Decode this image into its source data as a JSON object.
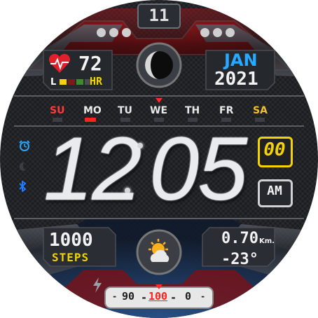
{
  "date": {
    "day_of_month": "11",
    "month": "JAN",
    "year": "2021"
  },
  "heart": {
    "value": "72",
    "unit": "HR",
    "level_prefix": "L",
    "level_index": 1
  },
  "weekdays": {
    "items": [
      "SU",
      "MO",
      "TU",
      "WE",
      "TH",
      "FR",
      "SA"
    ],
    "selected_index": 1,
    "colors": {
      "sunday": "#ff3b3b",
      "saturday": "#f2c12e",
      "default": "#e8e8e8",
      "selected_marker": "#ff2020"
    }
  },
  "time": {
    "hour": "12",
    "minute": "05",
    "seconds": "00",
    "ampm": "AM"
  },
  "steps": {
    "value": "1000",
    "label": "STEPS"
  },
  "distance": {
    "value": "0.70",
    "unit": "Km."
  },
  "weather": {
    "temperature": "-23°",
    "icon": "sun-cloud-icon"
  },
  "battery": {
    "left_label": "90",
    "value": "100",
    "right_label": "0"
  },
  "colors": {
    "accent_blue": "#29a8ff",
    "accent_yellow": "#f5d300",
    "accent_red": "#ff2a2a",
    "panel_red": "#7c1418",
    "panel_blue": "#1e3a63"
  },
  "icons": {
    "alarm": "alarm-icon",
    "moon": "moon-icon",
    "bluetooth": "bluetooth-icon",
    "charging": "bolt-icon",
    "moon_phase": "moon-phase-icon",
    "heart": "heart-icon"
  }
}
